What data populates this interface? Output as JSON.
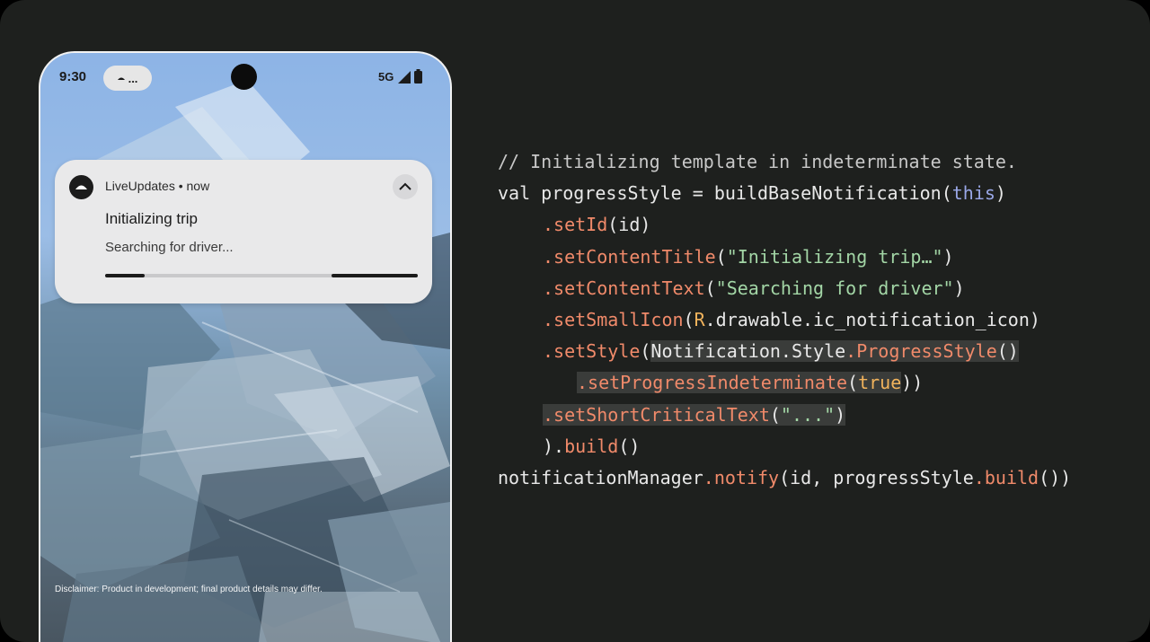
{
  "phone": {
    "status": {
      "time": "9:30",
      "chip_text": "...",
      "network": "5G",
      "icons": [
        "rideshare-icon",
        "signal-icon",
        "battery-icon"
      ]
    },
    "notification": {
      "app_name": "LiveUpdates",
      "separator": " • ",
      "timestamp": "now",
      "title": "Initializing trip",
      "text": "Searching for driver...",
      "progress_indeterminate": true,
      "expand_icon": "chevron-up-icon"
    },
    "disclaimer": "Disclaimer: Product in development; final product details may differ."
  },
  "code": {
    "comment": "// Initializing template in indeterminate state.",
    "line2": {
      "val": "val ",
      "var": "progressStyle",
      "eq": " = ",
      "call": "buildBaseNotification(",
      "this": "this",
      "close": ")"
    },
    "line3": {
      "fn": ".setId",
      "args": "(id)"
    },
    "line4": {
      "fn": ".setContentTitle",
      "open": "(",
      "str": "\"Initializing trip…\"",
      "close": ")"
    },
    "line5": {
      "fn": ".setContentText",
      "open": "(",
      "str": "\"Searching for driver\"",
      "close": ")"
    },
    "line6": {
      "fn": ".setSmallIcon",
      "open": "(",
      "r": "R",
      "rest": ".drawable.ic_notification_icon)"
    },
    "line7": {
      "fn": ".setStyle",
      "open": "(",
      "cls1": "Notification",
      "cls2": ".Style",
      "cls3": ".ProgressStyle",
      "close": "()"
    },
    "line8": {
      "fn": ".setProgressIndeterminate",
      "open": "(",
      "bool": "true",
      "close": "))"
    },
    "line9": {
      "fn": ".setShortCriticalText",
      "open": "(",
      "str": "\"...\"",
      "close": ")"
    },
    "line10": {
      "open": ").",
      "fn": "build",
      "close": "()"
    },
    "line11": {
      "obj": "notificationManager",
      "fn": ".notify",
      "args": "(id, progressStyle",
      "fn2": ".build",
      "close": "())"
    }
  },
  "colors": {
    "background": "#1e201e",
    "keyword": "#e8e8e8",
    "function": "#f08a6a",
    "string": "#a3d6a6",
    "this_keyword": "#9aa8e8",
    "highlight": "#3a3c3a"
  }
}
